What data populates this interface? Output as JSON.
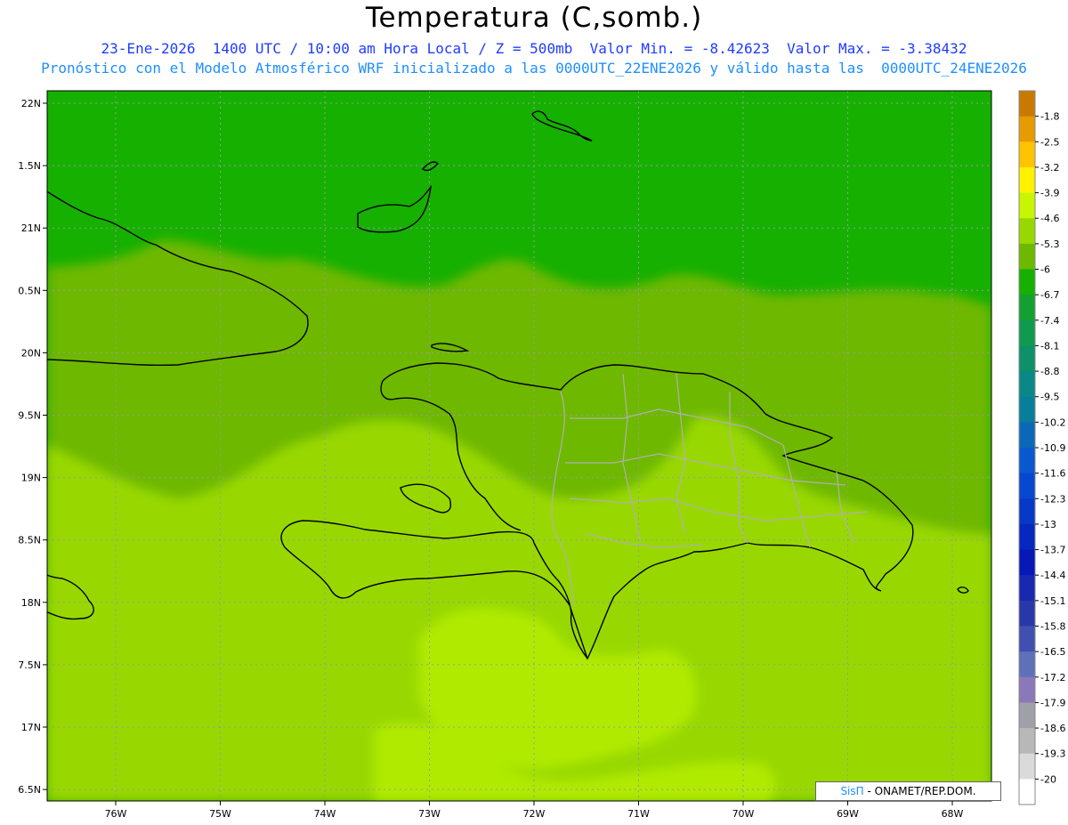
{
  "header": {
    "title": "Temperatura (C,somb.)",
    "line1": "23-Ene-2026  1400 UTC / 10:00 am Hora Local / Z = 500mb  Valor Min. = -8.42623  Valor Max. = -3.38432",
    "line2": "Pronóstico con el Modelo Atmosférico WRF inicializado a las 0000UTC_22ENE2026 y válido hasta las  0000UTC_24ENE2026"
  },
  "axes": {
    "lat_labels": [
      "22N",
      "1.5N",
      "21N",
      "0.5N",
      "20N",
      "9.5N",
      "19N",
      "8.5N",
      "18N",
      "7.5N",
      "17N",
      "6.5N"
    ],
    "lon_labels": [
      "76W",
      "75W",
      "74W",
      "73W",
      "72W",
      "71W",
      "70W",
      "69W",
      "68W"
    ]
  },
  "colorbar": {
    "labels": [
      "-1.8",
      "-2.5",
      "-3.2",
      "-3.9",
      "-4.6",
      "-5.3",
      "-6",
      "-6.7",
      "-7.4",
      "-8.1",
      "-8.8",
      "-9.5",
      "-10.2",
      "-10.9",
      "-11.6",
      "-12.3",
      "-13",
      "-13.7",
      "-14.4",
      "-15.1",
      "-15.8",
      "-16.5",
      "-17.2",
      "-17.9",
      "-18.6",
      "-19.3",
      "-20"
    ],
    "colors": [
      "#c87a00",
      "#e69b00",
      "#ffc400",
      "#fff200",
      "#c8f500",
      "#98d800",
      "#6eb800",
      "#16b000",
      "#14a030",
      "#109a50",
      "#0e9068",
      "#0a8888",
      "#087e9a",
      "#0a68b8",
      "#0a58d0",
      "#0848d0",
      "#0838c8",
      "#0628c0",
      "#0618b8",
      "#1828b0",
      "#2838a8",
      "#4050b0",
      "#6070b8",
      "#8a78b8",
      "#a0a0a8",
      "#b8b8b8",
      "#dadada",
      "#ffffff"
    ]
  },
  "credit": {
    "logo": "SisΠ",
    "text": "- ONAMET/REP.DOM."
  }
}
